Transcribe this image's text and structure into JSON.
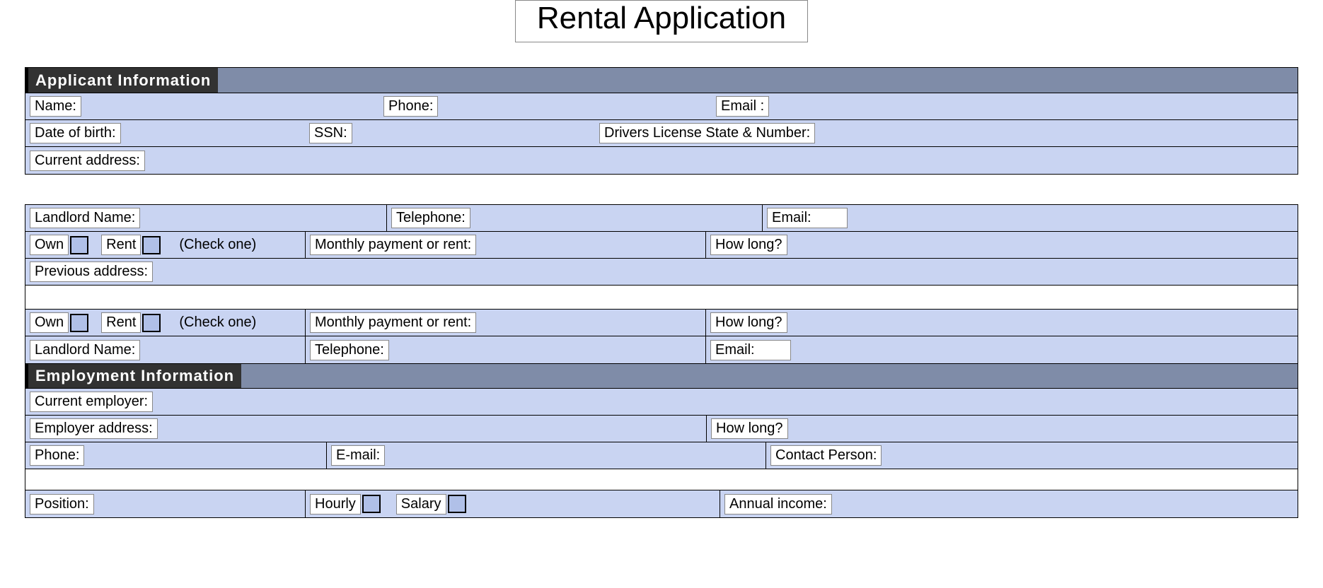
{
  "title": "Rental Application",
  "sections": {
    "applicant": {
      "header": "Applicant Information",
      "name": "Name:",
      "phone": "Phone:",
      "email": "Email :",
      "dob": "Date of birth:",
      "ssn": "SSN:",
      "dl": "Drivers License State & Number:",
      "current_address": "Current address:"
    },
    "residence": {
      "landlord_name": "Landlord Name:",
      "telephone": "Telephone:",
      "email": "Email:",
      "own": "Own",
      "rent": "Rent",
      "check_one": "(Check one)",
      "monthly": "Monthly payment or rent:",
      "how_long": "How long?",
      "previous_address": "Previous address:"
    },
    "employment": {
      "header": "Employment Information",
      "current_employer": "Current employer:",
      "employer_address": "Employer address:",
      "how_long": "How long?",
      "phone": "Phone:",
      "email": "E-mail:",
      "contact_person": "Contact Person:",
      "position": "Position:",
      "hourly": "Hourly",
      "salary": "Salary",
      "annual_income": "Annual income:"
    }
  }
}
